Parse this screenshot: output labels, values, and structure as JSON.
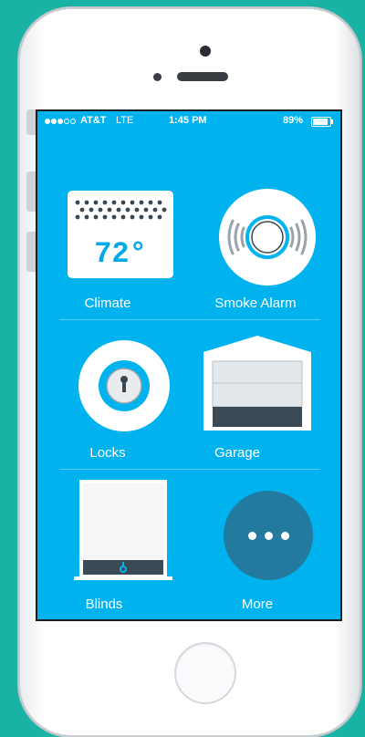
{
  "status_bar": {
    "carrier": "AT&T",
    "network": "LTE",
    "time": "1:45 PM",
    "battery": "89%",
    "battery_level": 0.89,
    "signal_bars_filled": 3,
    "signal_bars_total": 5
  },
  "devices": {
    "climate": {
      "label": "Climate",
      "temperature": "72°",
      "icon": "thermostat-icon"
    },
    "smoke_alarm": {
      "label": "Smoke Alarm",
      "icon": "smoke-alarm-icon"
    },
    "locks": {
      "label": "Locks",
      "icon": "lock-icon"
    },
    "garage": {
      "label": "Garage",
      "icon": "garage-door-icon"
    },
    "blinds": {
      "label": "Blinds",
      "icon": "blinds-icon"
    },
    "more": {
      "label": "More",
      "icon": "more-dots-icon"
    }
  },
  "colors": {
    "background": "#19b3a6",
    "screen": "#00b3ef",
    "accent_dark": "#227a9f",
    "panel_dark": "#3c4a55"
  }
}
